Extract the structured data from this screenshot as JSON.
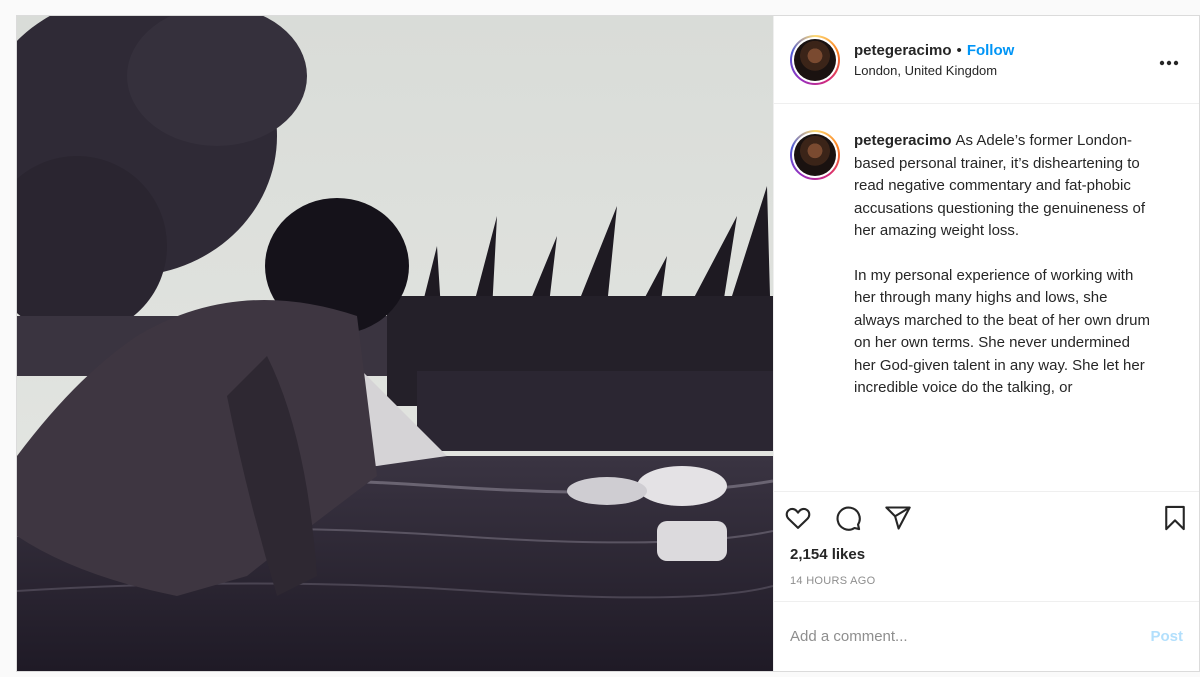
{
  "colors": {
    "accent": "#0095f6",
    "post_disabled": "#b2dffc",
    "muted": "#8e8e8e"
  },
  "header": {
    "username": "petegeracimo",
    "separator": "•",
    "follow_label": "Follow",
    "location": "London, United Kingdom",
    "more_icon": "more-horizontal-icon"
  },
  "caption": {
    "username": "petegeracimo",
    "paragraph1": "As Adele’s former London-based personal trainer, it’s disheartening to read negative commentary and fat-phobic accusations questioning the genuineness of her amazing weight loss.",
    "paragraph2": "In my personal experience of working with her through many highs and lows, she always marched to the beat of her own drum on her own terms. She never undermined her God-given talent in any way. She let her incredible voice do the talking, or"
  },
  "actions": {
    "icons": [
      "heart-icon",
      "comment-icon",
      "share-icon",
      "bookmark-icon"
    ],
    "likes": "2,154 likes",
    "timestamp": "14 HOURS AGO"
  },
  "comment_box": {
    "placeholder": "Add a comment...",
    "post_label": "Post"
  }
}
